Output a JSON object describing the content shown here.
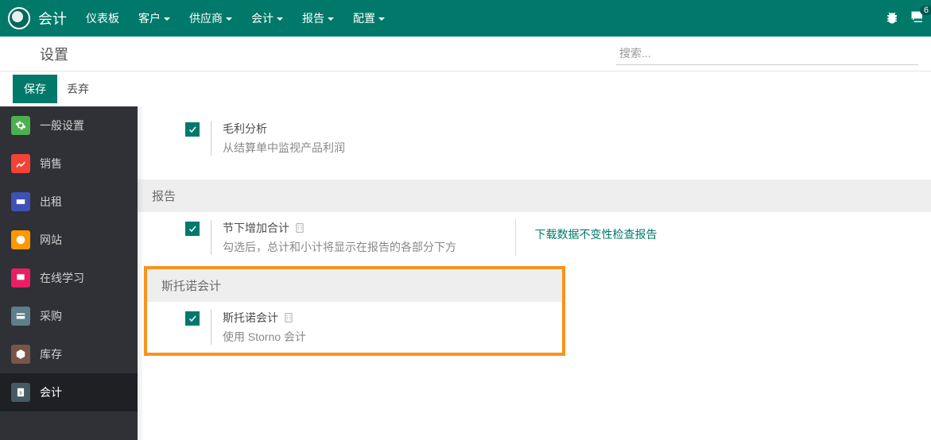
{
  "topbar": {
    "app": "会计",
    "menu": [
      "仪表板",
      "客户",
      "供应商",
      "会计",
      "报告",
      "配置"
    ],
    "badge": "6"
  },
  "subbar": {
    "breadcrumb": "设置",
    "search_placeholder": "搜索..."
  },
  "actions": {
    "save": "保存",
    "discard": "丢弃"
  },
  "sidebar": [
    {
      "label": "一般设置",
      "icon": "ic-general"
    },
    {
      "label": "销售",
      "icon": "ic-sales"
    },
    {
      "label": "出租",
      "icon": "ic-rental"
    },
    {
      "label": "网站",
      "icon": "ic-web"
    },
    {
      "label": "在线学习",
      "icon": "ic-elearn"
    },
    {
      "label": "采购",
      "icon": "ic-purchase"
    },
    {
      "label": "库存",
      "icon": "ic-stock"
    },
    {
      "label": "会计",
      "icon": "ic-account",
      "active": true
    }
  ],
  "content": {
    "profit": {
      "title": "毛利分析",
      "desc": "从结算单中监视产品利润"
    },
    "report_section": "报告",
    "subtotal": {
      "title": "节下增加合计",
      "desc": "勾选后，总计和小计将显示在报告的各部分下方"
    },
    "integrity_link": "下载数据不变性检查报告",
    "storno_section": "斯托诺会计",
    "storno": {
      "title": "斯托诺会计",
      "desc": "使用 Storno 会计"
    }
  }
}
